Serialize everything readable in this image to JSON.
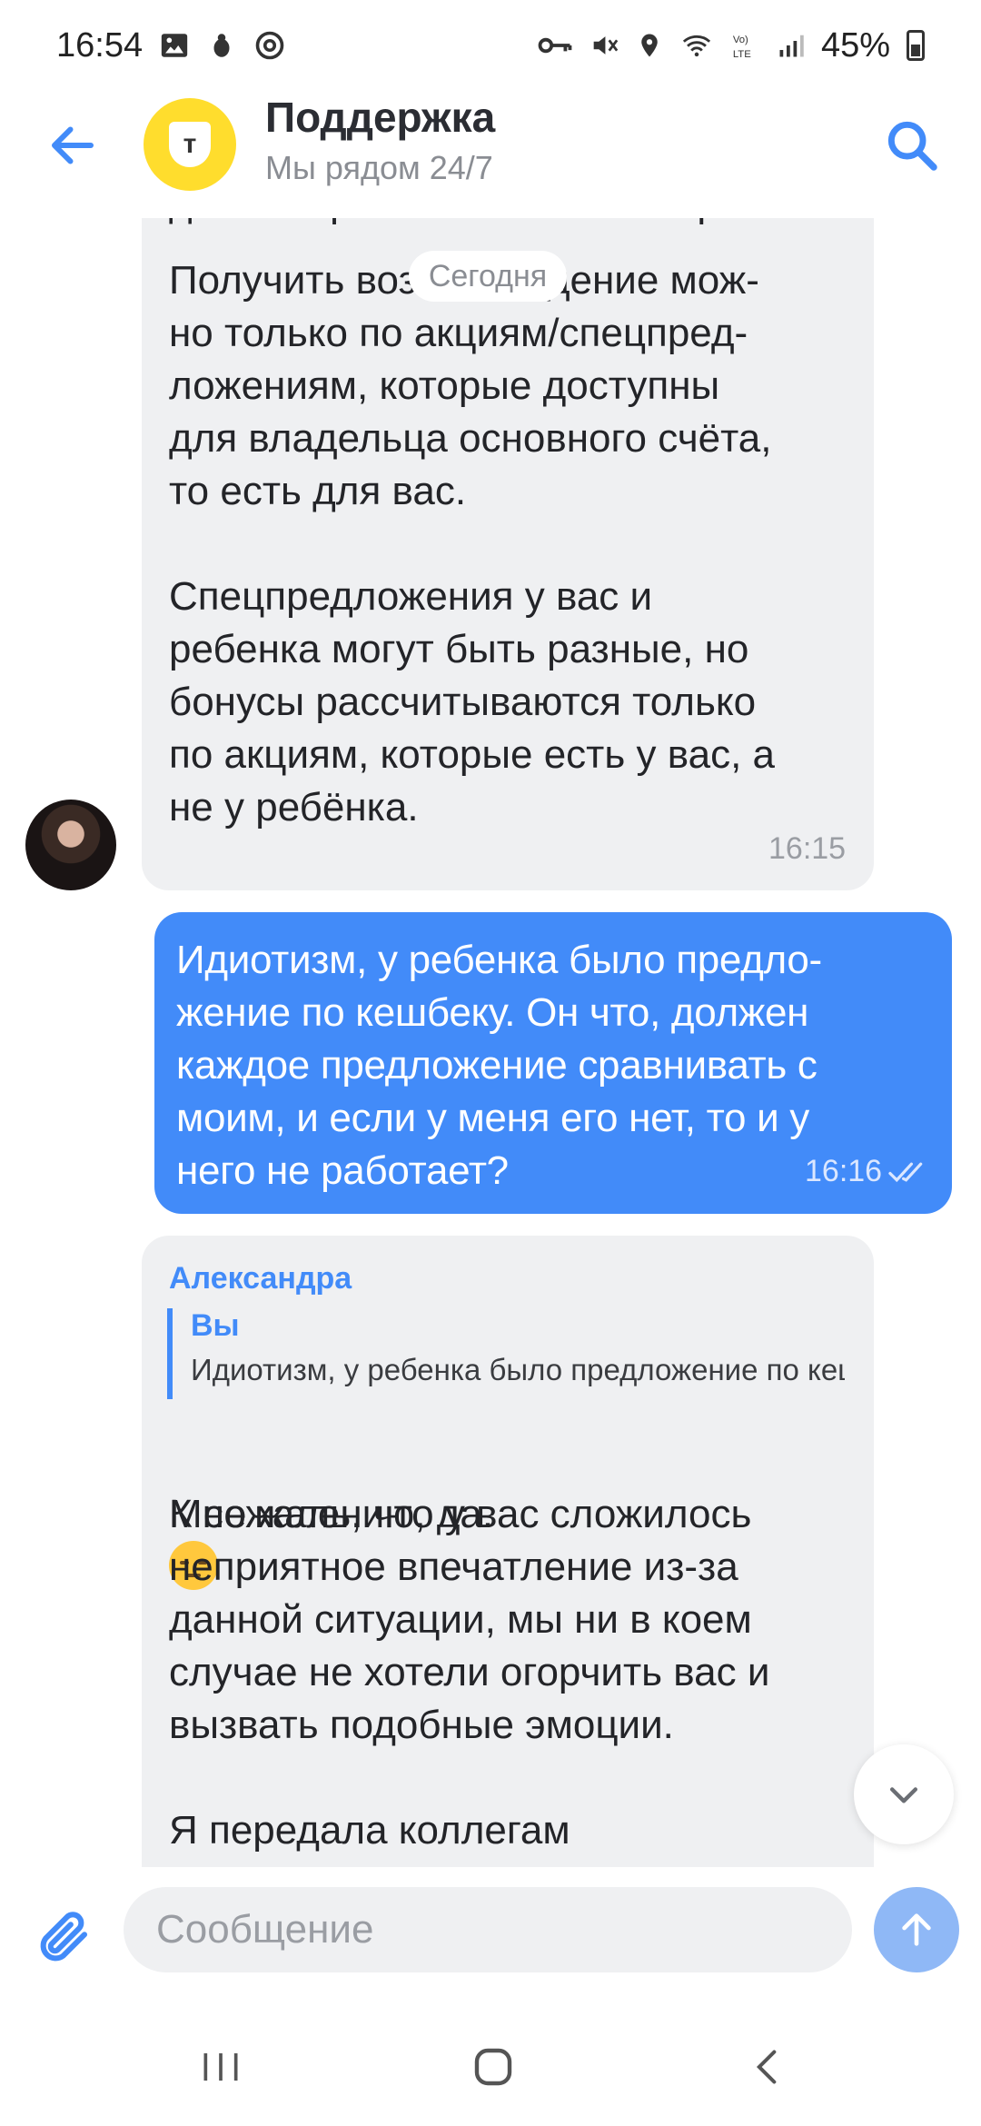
{
  "status_bar": {
    "time": "16:54",
    "left_icons": [
      "image-icon",
      "bug-icon",
      "at-icon"
    ],
    "right_icons": [
      "key-icon",
      "mute-icon",
      "location-icon",
      "wifi-icon",
      "volte-icon",
      "signal-icon",
      "battery-icon"
    ],
    "battery": "45%"
  },
  "header": {
    "title": "Поддержка",
    "subtitle": "Мы рядом 24/7",
    "logo_letter": "т",
    "logo_color": "#ffdd2d"
  },
  "chat": {
    "date_separator": "Сегодня",
    "messages": [
      {
        "direction": "incoming",
        "text_top_cut": "дены и хранятся на счете карты.",
        "text": "Получить вознаграждение мож-\nно только по акциям/спецпред-\nложениям, которые доступны\nдля владельца основного счёта,\nто есть для вас.\n\nСпецпредложения у вас и\nребенка могут быть разные, но\nбонусы рассчитываются только\nпо акциям, которые есть у вас, а\nне у ребёнка.",
        "time": "16:15"
      },
      {
        "direction": "outgoing",
        "text": "Идиотизм, у ребенка было предло-\nжение по кешбеку. Он что, должен\nкаждое предложение сравнивать с\nмоим, и если у меня его нет, то и у\nнего не работает?",
        "time": "16:16",
        "status": "read"
      },
      {
        "direction": "incoming",
        "sender": "Александра",
        "quote": {
          "author": "Вы",
          "text": "Идиотизм, у ребенка было предложение по кешбеку."
        },
        "text_line1": "К сожалению, да.",
        "text": "Мне жаль, что у вас сложилось\nнеприятное впечатление из-за\nданной ситуации, мы ни в коем\nслучае не хотели огорчить вас и\nвызвать подобные эмоции.\n\nЯ передала коллегам"
      }
    ]
  },
  "composer": {
    "placeholder": "Сообщение"
  },
  "colors": {
    "accent": "#428bf9",
    "incoming_bubble": "#eff0f2",
    "send_button": "#8fb8f6"
  }
}
